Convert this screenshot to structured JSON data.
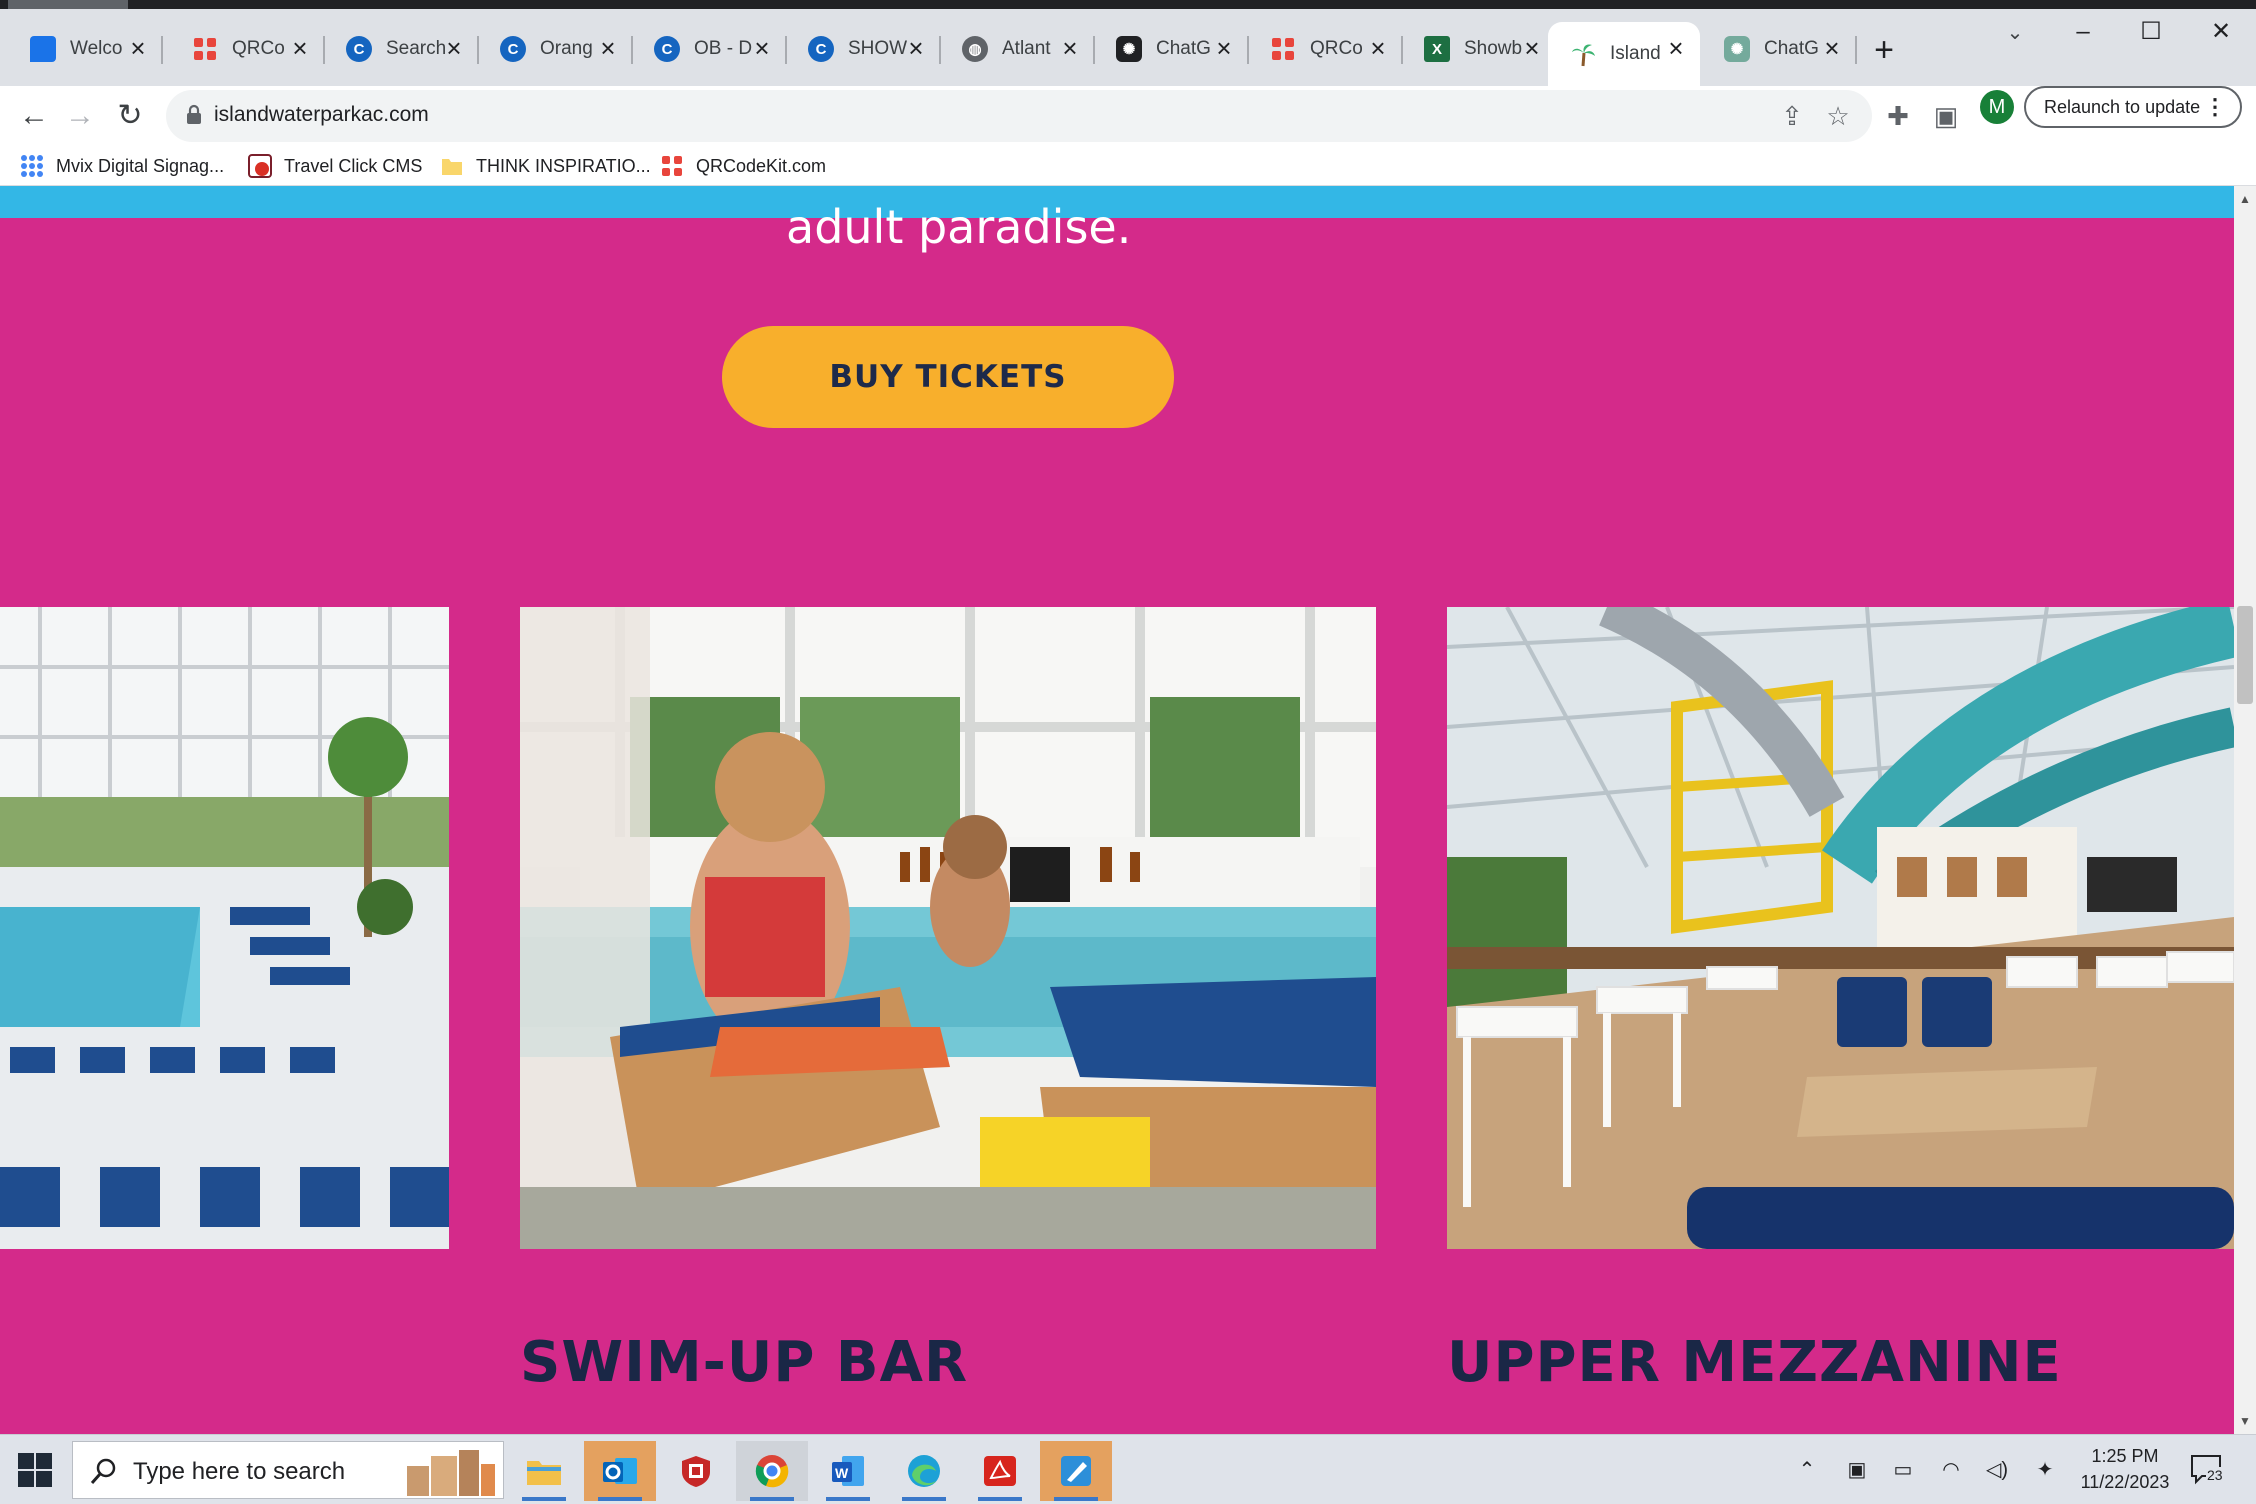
{
  "browser": {
    "tabs": [
      {
        "title": "Welco",
        "icon": "chat-icon",
        "color": "#1a73e8"
      },
      {
        "title": "QRCo",
        "icon": "qr-icon",
        "color": "#e8453c"
      },
      {
        "title": "Search",
        "icon": "c-icon",
        "color": "#1565c0"
      },
      {
        "title": "Orang",
        "icon": "c-icon",
        "color": "#1565c0"
      },
      {
        "title": "OB - D",
        "icon": "c-icon",
        "color": "#1565c0"
      },
      {
        "title": "SHOW",
        "icon": "c-icon",
        "color": "#1565c0"
      },
      {
        "title": "Atlant",
        "icon": "globe-icon",
        "color": "#5f6368"
      },
      {
        "title": "ChatG",
        "icon": "openai-icon",
        "color": "#202124"
      },
      {
        "title": "QRCo",
        "icon": "qr-icon",
        "color": "#e8453c"
      },
      {
        "title": "Showb",
        "icon": "excel-icon",
        "color": "#1d6f42"
      },
      {
        "title": "Island",
        "icon": "palm-icon",
        "color": "#33b7e6"
      },
      {
        "title": "ChatG",
        "icon": "openai-icon",
        "color": "#74aa9c"
      }
    ],
    "active_tab": 10,
    "url": "islandwaterparkac.com",
    "profile_initial": "M",
    "relaunch_label": "Relaunch to update",
    "bookmarks": [
      {
        "label": "Mvix Digital Signag...",
        "icon": "apps-grid-icon"
      },
      {
        "label": "Travel Click CMS",
        "icon": "travelclick-icon"
      },
      {
        "label": "THINK INSPIRATIO...",
        "icon": "folder-icon"
      },
      {
        "label": "QRCodeKit.com",
        "icon": "qr-icon"
      }
    ]
  },
  "page": {
    "hero_text": "adult paradise.",
    "buy_button": "BUY TICKETS",
    "captions": [
      "SWIM-UP BAR",
      "UPPER MEZZANINE"
    ],
    "colors": {
      "background": "#d42a8a",
      "banner": "#33b7e6",
      "button": "#f8af2c",
      "caption": "#1a2746"
    }
  },
  "taskbar": {
    "search_placeholder": "Type here to search",
    "time": "1:25 PM",
    "date": "11/22/2023",
    "notification_count": "23",
    "apps": [
      "file-explorer-icon",
      "outlook-icon",
      "security-icon",
      "chrome-icon",
      "word-icon",
      "edge-icon",
      "acrobat-icon",
      "paint-icon"
    ]
  }
}
